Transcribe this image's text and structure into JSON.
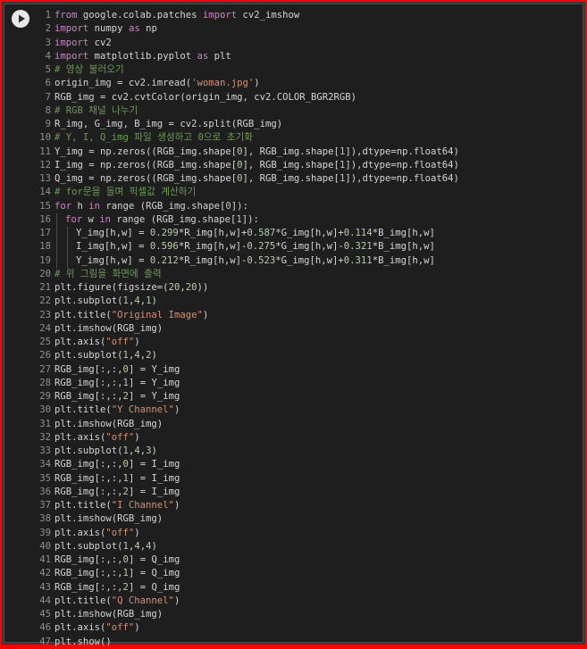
{
  "cell": {
    "run_button": "run-cell",
    "lines": [
      {
        "n": "1",
        "indent": 0,
        "segs": [
          [
            "kw",
            "from"
          ],
          [
            "src",
            " google.colab.patches "
          ],
          [
            "kw",
            "import"
          ],
          [
            "src",
            " cv2_imshow"
          ]
        ]
      },
      {
        "n": "2",
        "indent": 0,
        "segs": [
          [
            "kw",
            "import"
          ],
          [
            "src",
            " numpy "
          ],
          [
            "kw",
            "as"
          ],
          [
            "src",
            " np"
          ]
        ]
      },
      {
        "n": "3",
        "indent": 0,
        "segs": [
          [
            "kw",
            "import"
          ],
          [
            "src",
            " cv2"
          ]
        ]
      },
      {
        "n": "4",
        "indent": 0,
        "segs": [
          [
            "kw",
            "import"
          ],
          [
            "src",
            " matplotlib.pyplot "
          ],
          [
            "kw",
            "as"
          ],
          [
            "src",
            " plt"
          ]
        ]
      },
      {
        "n": "5",
        "indent": 0,
        "segs": [
          [
            "cm",
            "# 영상 불러오기"
          ]
        ]
      },
      {
        "n": "6",
        "indent": 0,
        "segs": [
          [
            "src",
            "origin_img = cv2.imread("
          ],
          [
            "str",
            "'woman.jpg'"
          ],
          [
            "src",
            ")"
          ]
        ]
      },
      {
        "n": "7",
        "indent": 0,
        "segs": [
          [
            "src",
            "RGB_img = cv2.cvtColor(origin_img, cv2.COLOR_BGR2RGB)"
          ]
        ]
      },
      {
        "n": "8",
        "indent": 0,
        "segs": [
          [
            "cm",
            "# RGB 채널 나누기"
          ]
        ]
      },
      {
        "n": "9",
        "indent": 0,
        "segs": [
          [
            "src",
            "R_img, G_img, B_img = cv2.split(RGB_img)"
          ]
        ]
      },
      {
        "n": "10",
        "indent": 0,
        "segs": [
          [
            "cm",
            "# Y, I, Q_img 파일 생성하고 0으로 초기화"
          ]
        ]
      },
      {
        "n": "11",
        "indent": 0,
        "segs": [
          [
            "src",
            "Y_img = np.zeros((RGB_img.shape["
          ],
          [
            "num",
            "0"
          ],
          [
            "src",
            "], RGB_img.shape["
          ],
          [
            "num",
            "1"
          ],
          [
            "src",
            "]),dtype=np.float64)"
          ]
        ]
      },
      {
        "n": "12",
        "indent": 0,
        "segs": [
          [
            "src",
            "I_img = np.zeros((RGB_img.shape["
          ],
          [
            "num",
            "0"
          ],
          [
            "src",
            "], RGB_img.shape["
          ],
          [
            "num",
            "1"
          ],
          [
            "src",
            "]),dtype=np.float64)"
          ]
        ]
      },
      {
        "n": "13",
        "indent": 0,
        "segs": [
          [
            "src",
            "Q_img = np.zeros((RGB_img.shape["
          ],
          [
            "num",
            "0"
          ],
          [
            "src",
            "], RGB_img.shape["
          ],
          [
            "num",
            "1"
          ],
          [
            "src",
            "]),dtype=np.float64)"
          ]
        ]
      },
      {
        "n": "14",
        "indent": 0,
        "segs": [
          [
            "cm",
            "# for문을 돌며 픽셀값 계산하기"
          ]
        ]
      },
      {
        "n": "15",
        "indent": 0,
        "segs": [
          [
            "kw",
            "for"
          ],
          [
            "src",
            " h "
          ],
          [
            "kw",
            "in"
          ],
          [
            "src",
            " range (RGB_img.shape["
          ],
          [
            "num",
            "0"
          ],
          [
            "src",
            "]):"
          ]
        ]
      },
      {
        "n": "16",
        "indent": 1,
        "segs": [
          [
            "kw",
            "for"
          ],
          [
            "src",
            " w "
          ],
          [
            "kw",
            "in"
          ],
          [
            "src",
            " range (RGB_img.shape["
          ],
          [
            "num",
            "1"
          ],
          [
            "src",
            "]):"
          ]
        ]
      },
      {
        "n": "17",
        "indent": 2,
        "segs": [
          [
            "src",
            "Y_img[h,w] = "
          ],
          [
            "num",
            "0.299"
          ],
          [
            "src",
            "*R_img[h,w]+"
          ],
          [
            "num",
            "0.587"
          ],
          [
            "src",
            "*G_img[h,w]+"
          ],
          [
            "num",
            "0.114"
          ],
          [
            "src",
            "*B_img[h,w]"
          ]
        ]
      },
      {
        "n": "18",
        "indent": 2,
        "segs": [
          [
            "src",
            "I_img[h,w] = "
          ],
          [
            "num",
            "0.596"
          ],
          [
            "src",
            "*R_img[h,w]-"
          ],
          [
            "num",
            "0.275"
          ],
          [
            "src",
            "*G_img[h,w]-"
          ],
          [
            "num",
            "0.321"
          ],
          [
            "src",
            "*B_img[h,w]"
          ]
        ]
      },
      {
        "n": "19",
        "indent": 2,
        "segs": [
          [
            "src",
            "Y_img[h,w] = "
          ],
          [
            "num",
            "0.212"
          ],
          [
            "src",
            "*R_img[h,w]-"
          ],
          [
            "num",
            "0.523"
          ],
          [
            "src",
            "*G_img[h,w]+"
          ],
          [
            "num",
            "0.311"
          ],
          [
            "src",
            "*B_img[h,w]"
          ]
        ]
      },
      {
        "n": "20",
        "indent": 0,
        "segs": [
          [
            "cm",
            "# 위 그림을 화면에 출력"
          ]
        ]
      },
      {
        "n": "21",
        "indent": 0,
        "segs": [
          [
            "src",
            "plt.figure(figsize=("
          ],
          [
            "num",
            "20"
          ],
          [
            "src",
            ","
          ],
          [
            "num",
            "20"
          ],
          [
            "src",
            "))"
          ]
        ]
      },
      {
        "n": "22",
        "indent": 0,
        "segs": [
          [
            "src",
            "plt.subplot("
          ],
          [
            "num",
            "1"
          ],
          [
            "src",
            ","
          ],
          [
            "num",
            "4"
          ],
          [
            "src",
            ","
          ],
          [
            "num",
            "1"
          ],
          [
            "src",
            ")"
          ]
        ]
      },
      {
        "n": "23",
        "indent": 0,
        "segs": [
          [
            "src",
            "plt.title("
          ],
          [
            "str",
            "\"Original Image\""
          ],
          [
            "src",
            ")"
          ]
        ]
      },
      {
        "n": "24",
        "indent": 0,
        "segs": [
          [
            "src",
            "plt.imshow(RGB_img)"
          ]
        ]
      },
      {
        "n": "25",
        "indent": 0,
        "segs": [
          [
            "src",
            "plt.axis("
          ],
          [
            "str",
            "\"off\""
          ],
          [
            "src",
            ")"
          ]
        ]
      },
      {
        "n": "26",
        "indent": 0,
        "segs": [
          [
            "src",
            "plt.subplot("
          ],
          [
            "num",
            "1"
          ],
          [
            "src",
            ","
          ],
          [
            "num",
            "4"
          ],
          [
            "src",
            ","
          ],
          [
            "num",
            "2"
          ],
          [
            "src",
            ")"
          ]
        ]
      },
      {
        "n": "27",
        "indent": 0,
        "segs": [
          [
            "src",
            "RGB_img[:,:,"
          ],
          [
            "num",
            "0"
          ],
          [
            "src",
            "] = Y_img"
          ]
        ]
      },
      {
        "n": "28",
        "indent": 0,
        "segs": [
          [
            "src",
            "RGB_img[:,:,"
          ],
          [
            "num",
            "1"
          ],
          [
            "src",
            "] = Y_img"
          ]
        ]
      },
      {
        "n": "29",
        "indent": 0,
        "segs": [
          [
            "src",
            "RGB_img[:,:,"
          ],
          [
            "num",
            "2"
          ],
          [
            "src",
            "] = Y_img"
          ]
        ]
      },
      {
        "n": "30",
        "indent": 0,
        "segs": [
          [
            "src",
            "plt.title("
          ],
          [
            "str",
            "\"Y Channel\""
          ],
          [
            "src",
            ")"
          ]
        ]
      },
      {
        "n": "31",
        "indent": 0,
        "segs": [
          [
            "src",
            "plt.imshow(RGB_img)"
          ]
        ]
      },
      {
        "n": "32",
        "indent": 0,
        "segs": [
          [
            "src",
            "plt.axis("
          ],
          [
            "str",
            "\"off\""
          ],
          [
            "src",
            ")"
          ]
        ]
      },
      {
        "n": "33",
        "indent": 0,
        "segs": [
          [
            "src",
            "plt.subplot("
          ],
          [
            "num",
            "1"
          ],
          [
            "src",
            ","
          ],
          [
            "num",
            "4"
          ],
          [
            "src",
            ","
          ],
          [
            "num",
            "3"
          ],
          [
            "src",
            ")"
          ]
        ]
      },
      {
        "n": "34",
        "indent": 0,
        "segs": [
          [
            "src",
            "RGB_img[:,:,"
          ],
          [
            "num",
            "0"
          ],
          [
            "src",
            "] = I_img"
          ]
        ]
      },
      {
        "n": "35",
        "indent": 0,
        "segs": [
          [
            "src",
            "RGB_img[:,:,"
          ],
          [
            "num",
            "1"
          ],
          [
            "src",
            "] = I_img"
          ]
        ]
      },
      {
        "n": "36",
        "indent": 0,
        "segs": [
          [
            "src",
            "RGB_img[:,:,"
          ],
          [
            "num",
            "2"
          ],
          [
            "src",
            "] = I_img"
          ]
        ]
      },
      {
        "n": "37",
        "indent": 0,
        "segs": [
          [
            "src",
            "plt.title("
          ],
          [
            "str",
            "\"I Channel\""
          ],
          [
            "src",
            ")"
          ]
        ]
      },
      {
        "n": "38",
        "indent": 0,
        "segs": [
          [
            "src",
            "plt.imshow(RGB_img)"
          ]
        ]
      },
      {
        "n": "39",
        "indent": 0,
        "segs": [
          [
            "src",
            "plt.axis("
          ],
          [
            "str",
            "\"off\""
          ],
          [
            "src",
            ")"
          ]
        ]
      },
      {
        "n": "40",
        "indent": 0,
        "segs": [
          [
            "src",
            "plt.subplot("
          ],
          [
            "num",
            "1"
          ],
          [
            "src",
            ","
          ],
          [
            "num",
            "4"
          ],
          [
            "src",
            ","
          ],
          [
            "num",
            "4"
          ],
          [
            "src",
            ")"
          ]
        ]
      },
      {
        "n": "41",
        "indent": 0,
        "segs": [
          [
            "src",
            "RGB_img[:,:,"
          ],
          [
            "num",
            "0"
          ],
          [
            "src",
            "] = Q_img"
          ]
        ]
      },
      {
        "n": "42",
        "indent": 0,
        "segs": [
          [
            "src",
            "RGB_img[:,:,"
          ],
          [
            "num",
            "1"
          ],
          [
            "src",
            "] = Q_img"
          ]
        ]
      },
      {
        "n": "43",
        "indent": 0,
        "segs": [
          [
            "src",
            "RGB_img[:,:,"
          ],
          [
            "num",
            "2"
          ],
          [
            "src",
            "] = Q_img"
          ]
        ]
      },
      {
        "n": "44",
        "indent": 0,
        "segs": [
          [
            "src",
            "plt.title("
          ],
          [
            "str",
            "\"Q Channel\""
          ],
          [
            "src",
            ")"
          ]
        ]
      },
      {
        "n": "45",
        "indent": 0,
        "segs": [
          [
            "src",
            "plt.imshow(RGB_img)"
          ]
        ]
      },
      {
        "n": "46",
        "indent": 0,
        "segs": [
          [
            "src",
            "plt.axis("
          ],
          [
            "str",
            "\"off\""
          ],
          [
            "src",
            ")"
          ]
        ]
      },
      {
        "n": "47",
        "indent": 0,
        "segs": [
          [
            "src",
            "plt.show()"
          ]
        ]
      }
    ]
  },
  "colors": {
    "frame_border": "#ff0000",
    "editor_bg": "#1e1e1e",
    "keyword": "#c586c0",
    "string": "#ce9178",
    "number": "#b5cea8",
    "comment": "#6a9955",
    "text": "#d4d4d4",
    "line_number": "#8f8f8f"
  }
}
